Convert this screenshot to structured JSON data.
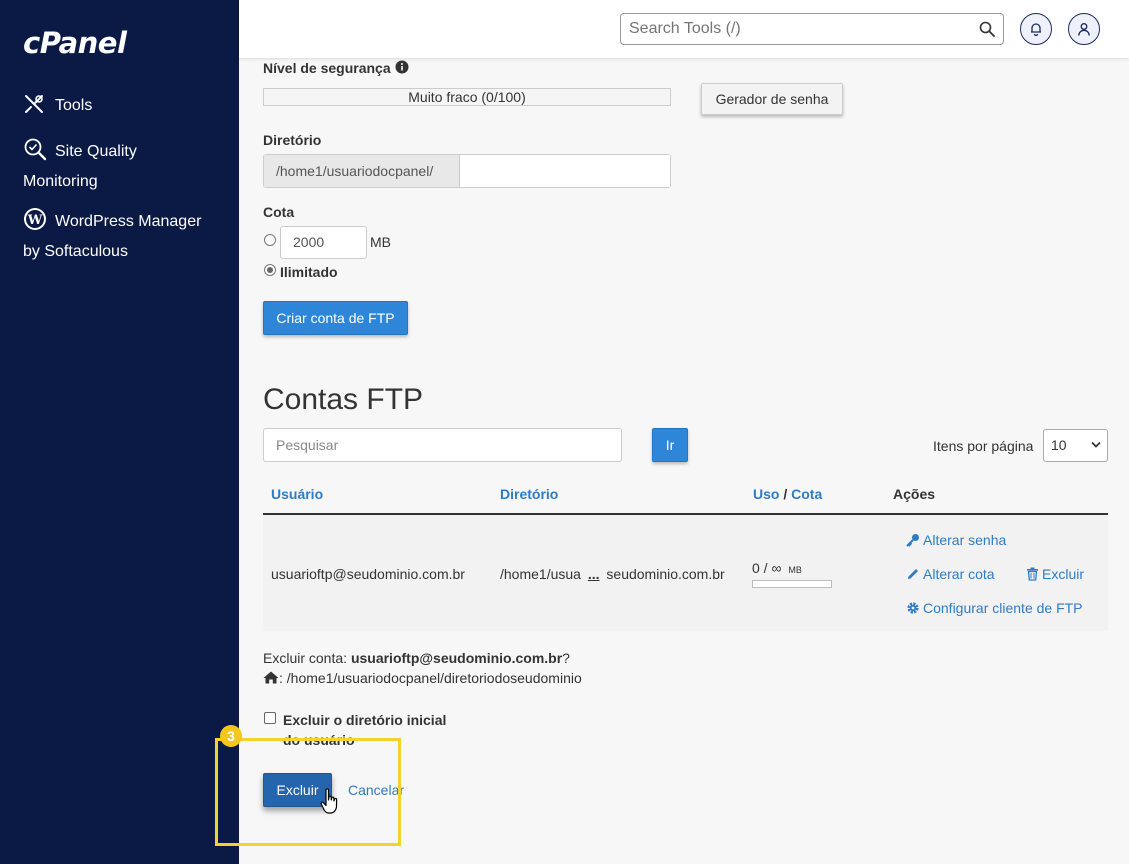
{
  "sidebar": {
    "logo": "cPanel",
    "items": [
      {
        "label": "Tools"
      },
      {
        "label_line1": "Site Quality",
        "label_line2": "Monitoring"
      },
      {
        "label_line1": "WordPress Manager",
        "label_line2": "by Softaculous"
      }
    ]
  },
  "header": {
    "search_placeholder": "Search Tools (/)"
  },
  "form": {
    "security_label": "Nível de segurança",
    "strength_text": "Muito fraco (0/100)",
    "generator_button": "Gerador de senha",
    "directory_label": "Diretório",
    "directory_prefix": "/home1/usuariodocpanel/",
    "quota_label": "Cota",
    "quota_value": "2000",
    "quota_unit": "MB",
    "unlimited_label": "Ilimitado",
    "create_button": "Criar conta de FTP"
  },
  "accounts": {
    "heading": "Contas FTP",
    "search_placeholder": "Pesquisar",
    "go_button": "Ir",
    "items_per_page_label": "Itens por página",
    "items_per_page_value": "10",
    "columns": {
      "user": "Usuário",
      "directory": "Diretório",
      "usage": "Uso",
      "separator": "/",
      "quota": "Cota",
      "actions": "Ações"
    },
    "row": {
      "user": "usuarioftp@seudominio.com.br",
      "dir_start": "/home1/usua",
      "dir_ellipsis": "...",
      "dir_end": "seudominio.com.br",
      "usage": "0 / ∞",
      "usage_unit": "MB",
      "usage_fraction": 0,
      "actions": {
        "change_password": "Alterar senha",
        "change_quota": "Alterar cota",
        "delete": "Excluir",
        "configure_client": "Configurar cliente de FTP"
      }
    }
  },
  "delete_dialog": {
    "prompt_prefix": "Excluir conta:",
    "account": "usuarioftp@seudominio.com.br",
    "prompt_suffix": "?",
    "home_path": ": /home1/usuariodocpanel/diretoriodoseudominio",
    "checkbox_line1": "Excluir o diretório inicial",
    "checkbox_line2": "do usuário",
    "delete_button": "Excluir",
    "cancel_link": "Cancelar"
  },
  "annotation": {
    "step": "3",
    "highlight_color": "#f4d22e"
  }
}
